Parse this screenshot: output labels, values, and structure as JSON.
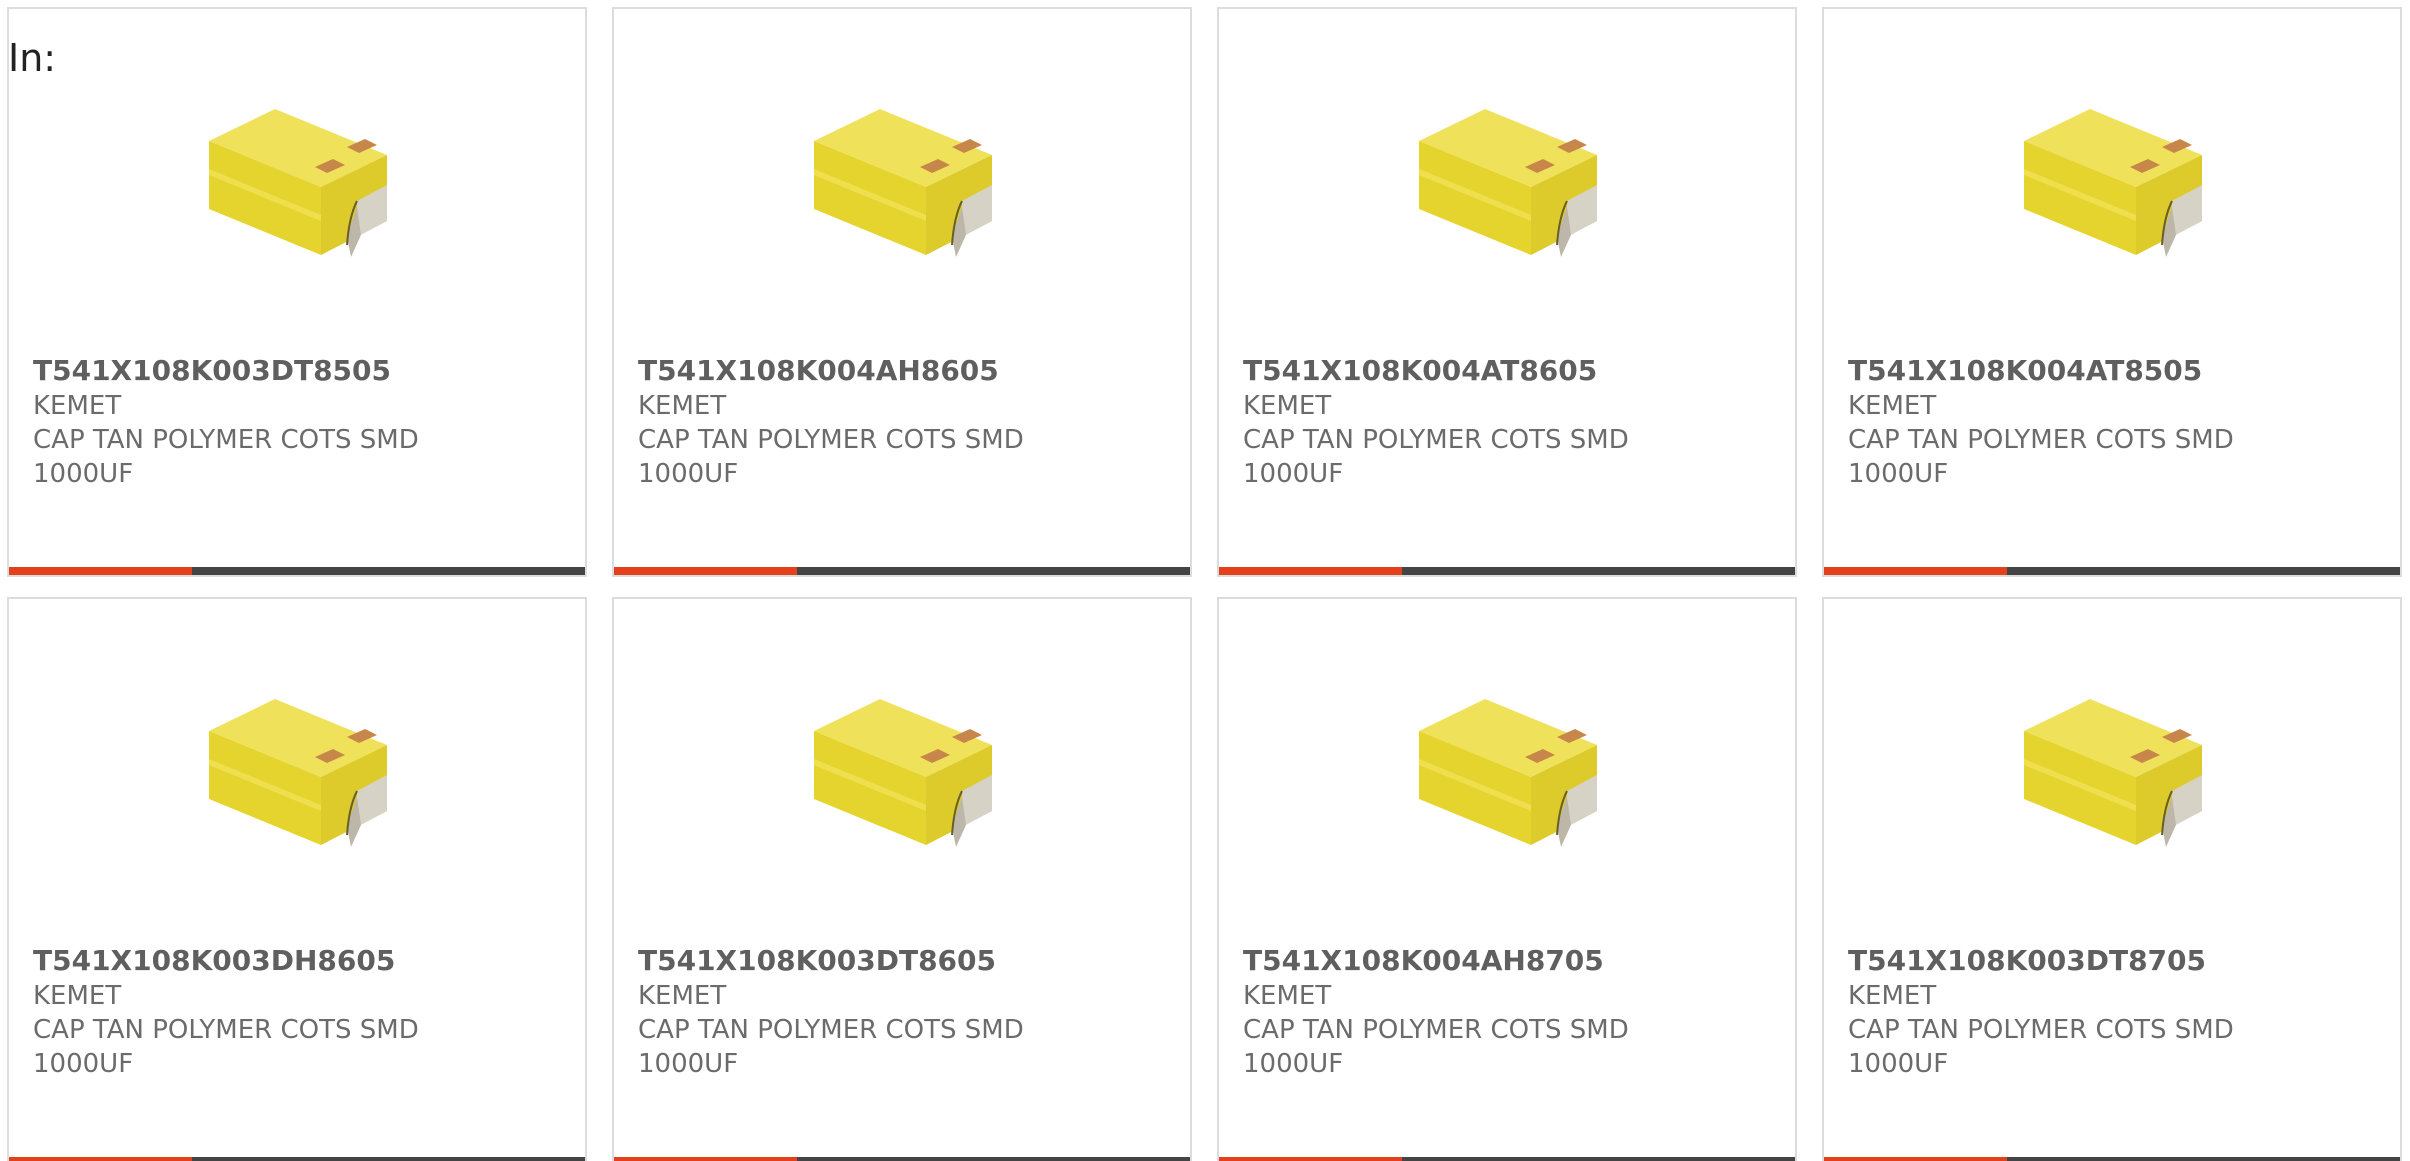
{
  "header": {
    "in_label": "In:"
  },
  "colors": {
    "accent": "#e4401b",
    "bar": "#444444",
    "cap_yellow": "#e9dc3a",
    "terminal": "#c8874a"
  },
  "products": [
    {
      "part_number": "T541X108K003DT8505",
      "manufacturer": "KEMET",
      "description": "CAP TAN POLYMER COTS SMD 1000UF",
      "image_icon": "tantalum-capacitor-icon"
    },
    {
      "part_number": "T541X108K004AH8605",
      "manufacturer": "KEMET",
      "description": "CAP TAN POLYMER COTS SMD 1000UF",
      "image_icon": "tantalum-capacitor-icon"
    },
    {
      "part_number": "T541X108K004AT8605",
      "manufacturer": "KEMET",
      "description": "CAP TAN POLYMER COTS SMD 1000UF",
      "image_icon": "tantalum-capacitor-icon"
    },
    {
      "part_number": "T541X108K004AT8505",
      "manufacturer": "KEMET",
      "description": "CAP TAN POLYMER COTS SMD 1000UF",
      "image_icon": "tantalum-capacitor-icon"
    },
    {
      "part_number": "T541X108K003DH8605",
      "manufacturer": "KEMET",
      "description": "CAP TAN POLYMER COTS SMD 1000UF",
      "image_icon": "tantalum-capacitor-icon"
    },
    {
      "part_number": "T541X108K003DT8605",
      "manufacturer": "KEMET",
      "description": "CAP TAN POLYMER COTS SMD 1000UF",
      "image_icon": "tantalum-capacitor-icon"
    },
    {
      "part_number": "T541X108K004AH8705",
      "manufacturer": "KEMET",
      "description": "CAP TAN POLYMER COTS SMD 1000UF",
      "image_icon": "tantalum-capacitor-icon"
    },
    {
      "part_number": "T541X108K003DT8705",
      "manufacturer": "KEMET",
      "description": "CAP TAN POLYMER COTS SMD 1000UF",
      "image_icon": "tantalum-capacitor-icon"
    }
  ]
}
